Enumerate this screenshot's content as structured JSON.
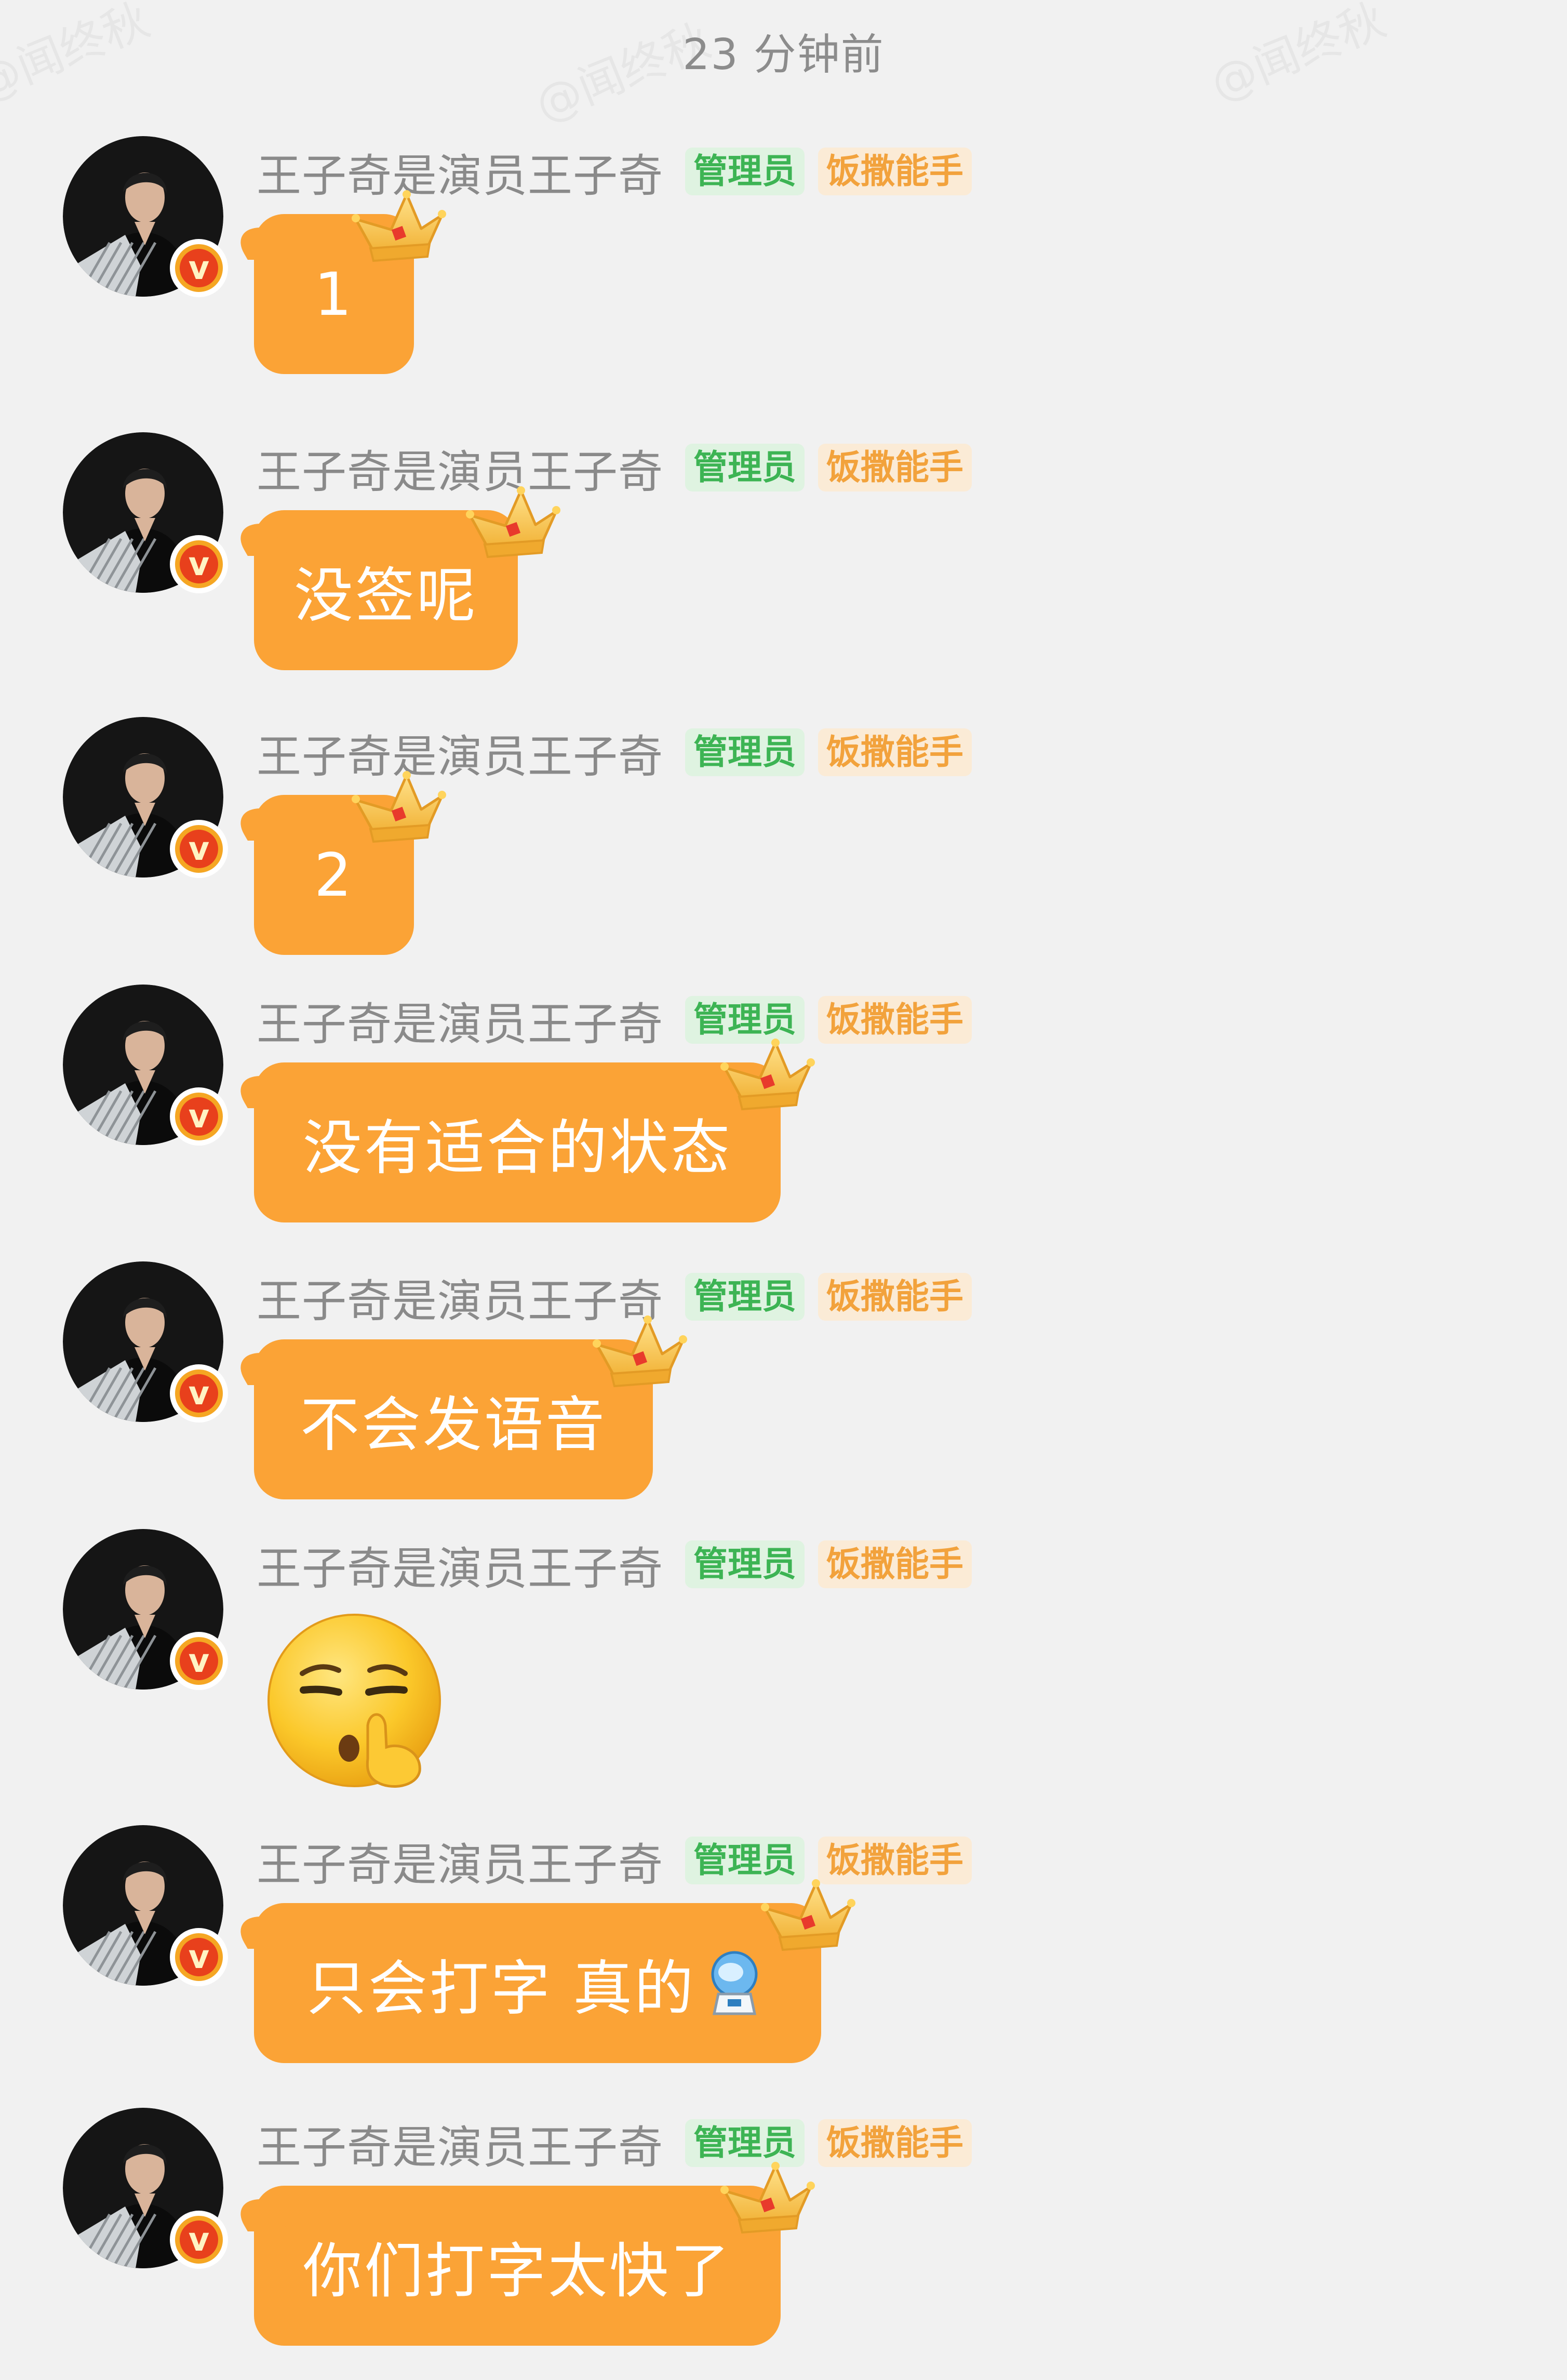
{
  "watermark": "@闻终秋",
  "timestamp": "23 分钟前",
  "messages": [
    {
      "sender": "王子奇是演员王子奇",
      "tags": [
        "管理员",
        "饭撒能手"
      ],
      "text": "1"
    },
    {
      "sender": "王子奇是演员王子奇",
      "tags": [
        "管理员",
        "饭撒能手"
      ],
      "text": "没签呢"
    },
    {
      "sender": "王子奇是演员王子奇",
      "tags": [
        "管理员",
        "饭撒能手"
      ],
      "text": "2"
    },
    {
      "sender": "王子奇是演员王子奇",
      "tags": [
        "管理员",
        "饭撒能手"
      ],
      "text": "没有适合的状态"
    },
    {
      "sender": "王子奇是演员王子奇",
      "tags": [
        "管理员",
        "饭撒能手"
      ],
      "text": "不会发语音"
    },
    {
      "sender": "王子奇是演员王子奇",
      "tags": [
        "管理员",
        "饭撒能手"
      ],
      "sticker": "shush-emoji-icon"
    },
    {
      "sender": "王子奇是演员王子奇",
      "tags": [
        "管理员",
        "饭撒能手"
      ],
      "text": "只会打字 真的",
      "inline_emoji": "astronaut-emoji-icon"
    },
    {
      "sender": "王子奇是演员王子奇",
      "tags": [
        "管理员",
        "饭撒能手"
      ],
      "text": "你们打字太快了"
    }
  ],
  "colors": {
    "background": "#f1f1f1",
    "bubble": "#fba336",
    "admin_tag_bg": "#dff3e1",
    "admin_tag_text": "#3db454",
    "fan_tag_bg": "#fbebd6",
    "fan_tag_text": "#f2a23c",
    "verified_badge": "#e8401c"
  },
  "icons": {
    "avatar": "avatar-photo",
    "verified": "verified-v-icon",
    "bubble_decoration": "crown-icon"
  }
}
